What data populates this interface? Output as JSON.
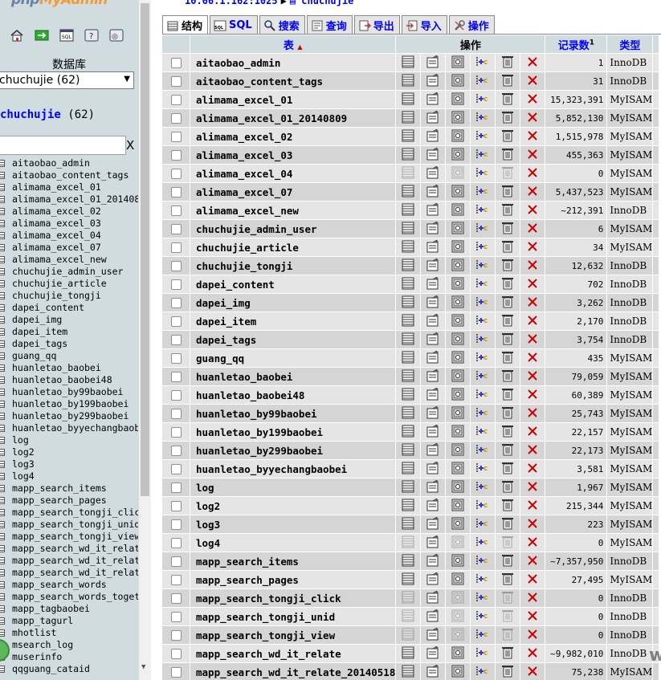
{
  "nav": {
    "logo_prefix": "php",
    "logo_main": "MyAdmin",
    "icons": [
      "home-icon",
      "exit-icon",
      "sql-query-icon",
      "help-icon",
      "docs-icon"
    ],
    "database_label": "数据库",
    "database_select": "chuchujie (62)",
    "db_title_name": "chuchujie",
    "db_title_count": " (62)",
    "filter_placeholder": "",
    "filter_clear": "X",
    "tables": [
      "aitaobao_admin",
      "aitaobao_content_tags",
      "alimama_excel_01",
      "alimama_excel_01_20140809",
      "alimama_excel_02",
      "alimama_excel_03",
      "alimama_excel_04",
      "alimama_excel_07",
      "alimama_excel_new",
      "chuchujie_admin_user",
      "chuchujie_article",
      "chuchujie_tongji",
      "dapei_content",
      "dapei_img",
      "dapei_item",
      "dapei_tags",
      "guang_qq",
      "huanletao_baobei",
      "huanletao_baobei48",
      "huanletao_by99baobei",
      "huanletao_by199baobei",
      "huanletao_by299baobei",
      "huanletao_byyechangbaobei",
      "log",
      "log2",
      "log3",
      "log4",
      "mapp_search_items",
      "mapp_search_pages",
      "mapp_search_tongji_click",
      "mapp_search_tongji_unid",
      "mapp_search_tongji_view",
      "mapp_search_wd_it_relate",
      "mapp_search_wd_it_relate_",
      "mapp_search_wd_it_relate_",
      "mapp_search_words",
      "mapp_search_words_toget",
      "mapp_tagbaobei",
      "mapp_tagurl",
      "mhotlist",
      "msearch_log",
      "muserinfo",
      "qqguang_cataid"
    ]
  },
  "breadcrumb": {
    "server": "10.66.1.162:1025",
    "database": "chuchujie"
  },
  "tabs": [
    {
      "label": "结构",
      "icon": "structure-icon",
      "active": true
    },
    {
      "label": "SQL",
      "icon": "sql-icon",
      "active": false
    },
    {
      "label": "搜索",
      "icon": "search-icon",
      "active": false
    },
    {
      "label": "查询",
      "icon": "query-icon",
      "active": false
    },
    {
      "label": "导出",
      "icon": "export-icon",
      "active": false
    },
    {
      "label": "导入",
      "icon": "import-icon",
      "active": false
    },
    {
      "label": "操作",
      "icon": "operations-icon",
      "active": false
    }
  ],
  "table_header": {
    "table": "表",
    "sort_arrow": "▲",
    "actions": "操作",
    "rows": "记录数",
    "rows_footnote": "1",
    "type": "类型"
  },
  "rows": [
    {
      "name": "aitaobao_admin",
      "records": "1",
      "type": "InnoDB",
      "empty": false
    },
    {
      "name": "aitaobao_content_tags",
      "records": "31",
      "type": "InnoDB",
      "empty": false
    },
    {
      "name": "alimama_excel_01",
      "records": "15,323,391",
      "type": "MyISAM",
      "empty": false
    },
    {
      "name": "alimama_excel_01_20140809",
      "records": "5,852,130",
      "type": "MyISAM",
      "empty": false
    },
    {
      "name": "alimama_excel_02",
      "records": "1,515,978",
      "type": "MyISAM",
      "empty": false
    },
    {
      "name": "alimama_excel_03",
      "records": "455,363",
      "type": "MyISAM",
      "empty": false
    },
    {
      "name": "alimama_excel_04",
      "records": "0",
      "type": "MyISAM",
      "empty": true
    },
    {
      "name": "alimama_excel_07",
      "records": "5,437,523",
      "type": "MyISAM",
      "empty": false
    },
    {
      "name": "alimama_excel_new",
      "records": "~212,391",
      "type": "InnoDB",
      "empty": false
    },
    {
      "name": "chuchujie_admin_user",
      "records": "6",
      "type": "MyISAM",
      "empty": false
    },
    {
      "name": "chuchujie_article",
      "records": "34",
      "type": "MyISAM",
      "empty": false
    },
    {
      "name": "chuchujie_tongji",
      "records": "12,632",
      "type": "InnoDB",
      "empty": false
    },
    {
      "name": "dapei_content",
      "records": "702",
      "type": "InnoDB",
      "empty": false
    },
    {
      "name": "dapei_img",
      "records": "3,262",
      "type": "InnoDB",
      "empty": false
    },
    {
      "name": "dapei_item",
      "records": "2,170",
      "type": "InnoDB",
      "empty": false
    },
    {
      "name": "dapei_tags",
      "records": "3,754",
      "type": "InnoDB",
      "empty": false
    },
    {
      "name": "guang_qq",
      "records": "435",
      "type": "MyISAM",
      "empty": false
    },
    {
      "name": "huanletao_baobei",
      "records": "79,059",
      "type": "MyISAM",
      "empty": false
    },
    {
      "name": "huanletao_baobei48",
      "records": "60,389",
      "type": "MyISAM",
      "empty": false
    },
    {
      "name": "huanletao_by99baobei",
      "records": "25,743",
      "type": "MyISAM",
      "empty": false
    },
    {
      "name": "huanletao_by199baobei",
      "records": "22,157",
      "type": "MyISAM",
      "empty": false
    },
    {
      "name": "huanletao_by299baobei",
      "records": "22,173",
      "type": "MyISAM",
      "empty": false
    },
    {
      "name": "huanletao_byyechangbaobei",
      "records": "3,581",
      "type": "MyISAM",
      "empty": false
    },
    {
      "name": "log",
      "records": "1,967",
      "type": "MyISAM",
      "empty": false
    },
    {
      "name": "log2",
      "records": "215,344",
      "type": "MyISAM",
      "empty": false
    },
    {
      "name": "log3",
      "records": "223",
      "type": "MyISAM",
      "empty": false
    },
    {
      "name": "log4",
      "records": "0",
      "type": "MyISAM",
      "empty": true
    },
    {
      "name": "mapp_search_items",
      "records": "~7,357,950",
      "type": "InnoDB",
      "empty": false
    },
    {
      "name": "mapp_search_pages",
      "records": "27,495",
      "type": "MyISAM",
      "empty": false
    },
    {
      "name": "mapp_search_tongji_click",
      "records": "0",
      "type": "InnoDB",
      "empty": true
    },
    {
      "name": "mapp_search_tongji_unid",
      "records": "0",
      "type": "InnoDB",
      "empty": true
    },
    {
      "name": "mapp_search_tongji_view",
      "records": "0",
      "type": "InnoDB",
      "empty": true
    },
    {
      "name": "mapp_search_wd_it_relate",
      "records": "~9,982,010",
      "type": "InnoDB",
      "empty": false
    },
    {
      "name": "mapp_search_wd_it_relate_20140518",
      "records": "75,238",
      "type": "MyISAM",
      "empty": false
    }
  ],
  "watermark": "www.wooyun.org",
  "colors": {
    "nav_bg": "#d0dce0",
    "header_bg": "#d0dce0",
    "row_odd": "#e5e5e5",
    "row_even": "#d5d5d5",
    "link": "#0000ff",
    "drop_red": "#cc0000"
  }
}
